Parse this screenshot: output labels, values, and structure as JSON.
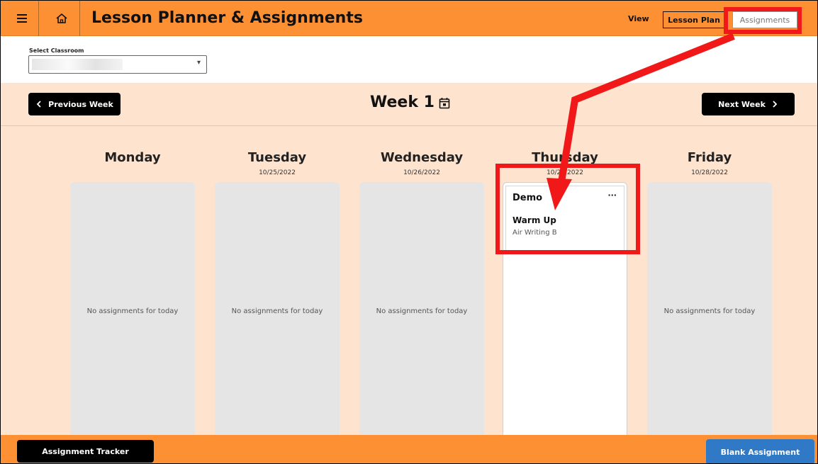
{
  "header": {
    "title": "Lesson Planner & Assignments",
    "view_label": "View",
    "view_options": [
      "Lesson Plan",
      "Assignments"
    ],
    "selected_view": "Assignments"
  },
  "classroom": {
    "label": "Select Classroom",
    "value": ""
  },
  "week": {
    "title": "Week 1",
    "prev_label": "Previous Week",
    "next_label": "Next Week"
  },
  "days": [
    {
      "name": "Monday",
      "date": "",
      "empty_text": "No assignments for today"
    },
    {
      "name": "Tuesday",
      "date": "10/25/2022",
      "empty_text": "No assignments for today"
    },
    {
      "name": "Wednesday",
      "date": "10/26/2022",
      "empty_text": "No assignments for today"
    },
    {
      "name": "Thursday",
      "date": "10/27/2022",
      "empty_text": ""
    },
    {
      "name": "Friday",
      "date": "10/28/2022",
      "empty_text": "No assignments for today"
    }
  ],
  "assignment_card": {
    "title": "Demo",
    "menu": "···",
    "activity": "Warm Up",
    "detail": "Air Writing B"
  },
  "footer": {
    "tracker_label": "Assignment Tracker",
    "blank_label": "Blank Assignment"
  },
  "colors": {
    "orange": "#fd9033",
    "peach": "#fee4cf",
    "blue": "#3079c6",
    "annotation_red": "#f01818"
  },
  "icons": [
    "hamburger-menu-icon",
    "home-icon",
    "calendar-icon",
    "chevron-left-icon",
    "chevron-right-icon",
    "dropdown-caret-icon"
  ]
}
